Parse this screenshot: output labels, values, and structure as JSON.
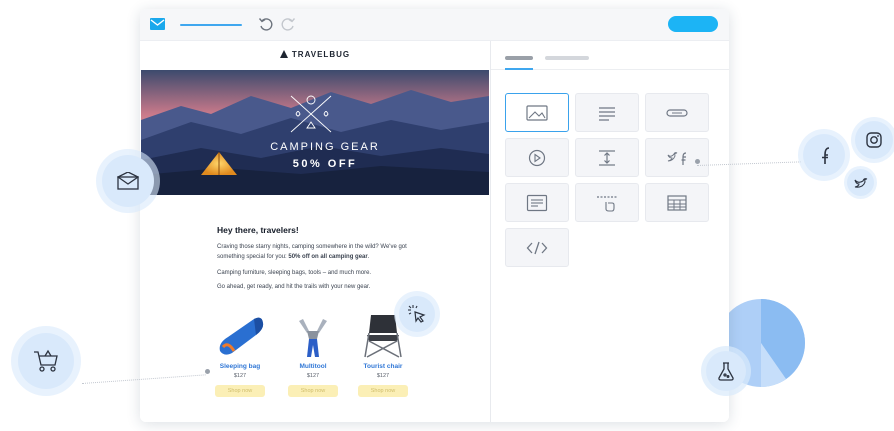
{
  "toolbar": {
    "mail_icon": "envelope-icon",
    "undo_icon": "undo-icon",
    "redo_icon": "redo-icon"
  },
  "email": {
    "brand": "TRAVELBUG",
    "hero_title": "CAMPING GEAR",
    "hero_subtitle": "50% OFF",
    "greeting": "Hey there, travelers!",
    "para1_part1": "Craving those starry nights, camping somewhere in the wild? We've got something special for you: ",
    "para1_bold": "50% off on all camping gear",
    "para1_end": ".",
    "para2": "Camping furniture, sleeping bags, tools – and much more.",
    "para3": "Go ahead, get ready, and hit the trails with your new gear.",
    "products": [
      {
        "name": "Sleeping bag",
        "price": "$127",
        "button": "Shop now"
      },
      {
        "name": "Multitool",
        "price": "$127",
        "button": "Shop now"
      },
      {
        "name": "Tourist chair",
        "price": "$127",
        "button": "Shop now"
      }
    ]
  },
  "panel": {
    "blocks": [
      "image-block-icon",
      "text-block-icon",
      "button-block-icon",
      "video-block-icon",
      "spacer-block-icon",
      "social-block-icon",
      "text-box-block-icon",
      "divider-block-icon",
      "table-block-icon",
      "html-code-block-icon"
    ]
  },
  "colors": {
    "accent": "#1cb4f5",
    "link": "#3077d6",
    "button_bg": "#fbefb6"
  }
}
